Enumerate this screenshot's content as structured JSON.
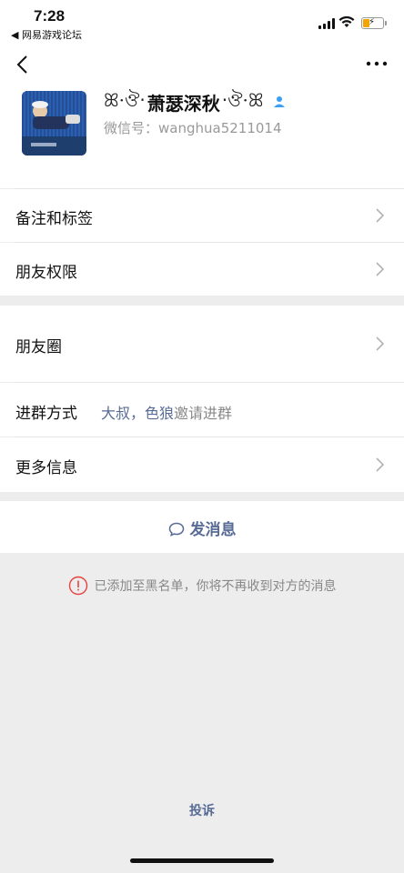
{
  "status_bar": {
    "time": "7:28",
    "back_app": "◀ 网易游戏论坛"
  },
  "profile": {
    "deco_left": "ꕤ·ঔ‧",
    "nickname": "萧瑟深秋",
    "deco_right": "‧ঔ·ꕤ",
    "wechat_id": "微信号：wanghua5211014",
    "gender_icon_color": "#3a9ff5"
  },
  "menu": {
    "remarks_tags": "备注和标签",
    "friend_permissions": "朋友权限",
    "moments": "朋友圈",
    "join_method_label": "进群方式",
    "join_method_value_link": "大叔，色狼",
    "join_method_value_text": "邀请进群",
    "more_info": "更多信息"
  },
  "actions": {
    "send_message": "发消息",
    "blacklist_notice": "已添加至黑名单，你将不再收到对方的消息",
    "report": "投诉"
  },
  "colors": {
    "link": "#576b95",
    "warning": "#e64340"
  }
}
